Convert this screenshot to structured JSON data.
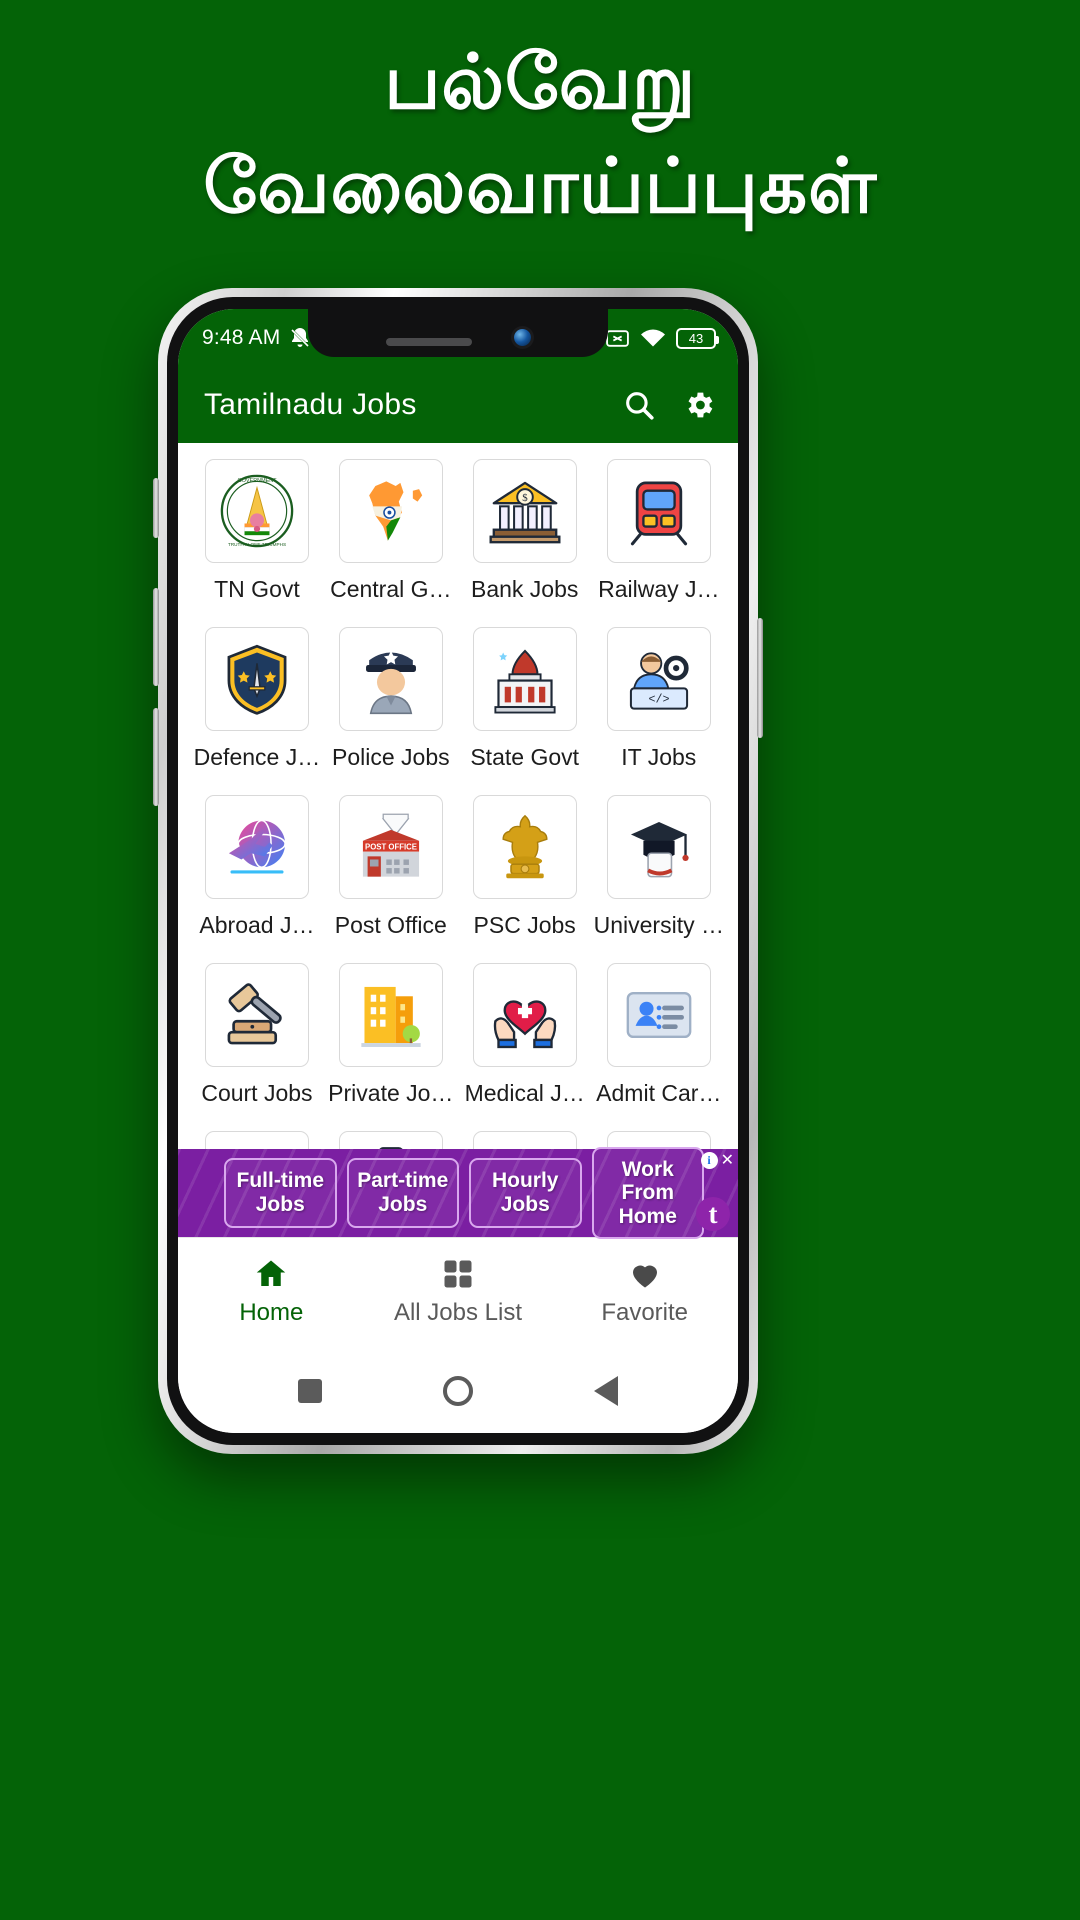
{
  "promo": {
    "line1": "பல்வேறு",
    "line2": "வேலைவாய்ப்புகள்",
    "bg_color": "#046307"
  },
  "status_bar": {
    "time": "9:48 AM",
    "silent_icon": "bell-muted-icon",
    "cast_icon": "cast-off-icon",
    "wifi_icon": "wifi-icon",
    "battery_level": "43"
  },
  "app_bar": {
    "title": "Tamilnadu Jobs",
    "search_icon": "search-icon",
    "settings_icon": "gear-icon",
    "bg_color": "#046307"
  },
  "grid": {
    "items": [
      {
        "label": "TN Govt",
        "icon": "tn-govt-emblem-icon"
      },
      {
        "label": "Central G…",
        "icon": "india-map-flag-icon"
      },
      {
        "label": "Bank Jobs",
        "icon": "bank-building-icon"
      },
      {
        "label": "Railway J…",
        "icon": "train-icon"
      },
      {
        "label": "Defence J…",
        "icon": "shield-sword-icon"
      },
      {
        "label": "Police Jobs",
        "icon": "police-officer-icon"
      },
      {
        "label": "State Govt",
        "icon": "government-building-icon"
      },
      {
        "label": "IT Jobs",
        "icon": "developer-code-icon"
      },
      {
        "label": "Abroad J…",
        "icon": "airplane-globe-icon"
      },
      {
        "label": "Post Office",
        "icon": "post-office-icon"
      },
      {
        "label": "PSC Jobs",
        "icon": "ashoka-emblem-icon"
      },
      {
        "label": "University …",
        "icon": "graduation-cap-icon"
      },
      {
        "label": "Court Jobs",
        "icon": "gavel-icon"
      },
      {
        "label": "Private Jo…",
        "icon": "office-tower-icon"
      },
      {
        "label": "Medical J…",
        "icon": "hands-heart-icon"
      },
      {
        "label": "Admit Car…",
        "icon": "id-card-icon"
      },
      {
        "label": "",
        "icon": "books-icon"
      },
      {
        "label": "",
        "icon": "clipboard-check-icon"
      },
      {
        "label": "",
        "icon": "quiz-paper-icon"
      },
      {
        "label": "",
        "icon": "question-paper-icon"
      }
    ]
  },
  "ad": {
    "chips": [
      "Full-time\nJobs",
      "Part-time\nJobs",
      "Hourly\nJobs",
      "Work From\nHome"
    ],
    "chip1_l1": "Full-time",
    "chip1_l2": "Jobs",
    "chip2_l1": "Part-time",
    "chip2_l2": "Jobs",
    "chip3_l1": "Hourly",
    "chip3_l2": "Jobs",
    "chip4_l1": "Work From",
    "chip4_l2": "Home",
    "info_badge": "i",
    "close_badge": "✕",
    "advertiser_logo": "t",
    "bg_color": "#7b1fa2"
  },
  "bottom_nav": {
    "items": [
      {
        "label": "Home",
        "icon": "home-icon",
        "active": true
      },
      {
        "label": "All Jobs List",
        "icon": "grid-icon",
        "active": false
      },
      {
        "label": "Favorite",
        "icon": "heart-icon",
        "active": false
      }
    ],
    "active_color": "#046307"
  },
  "system_nav": {
    "recents_icon": "square-icon",
    "home_icon": "circle-icon",
    "back_icon": "triangle-back-icon"
  }
}
